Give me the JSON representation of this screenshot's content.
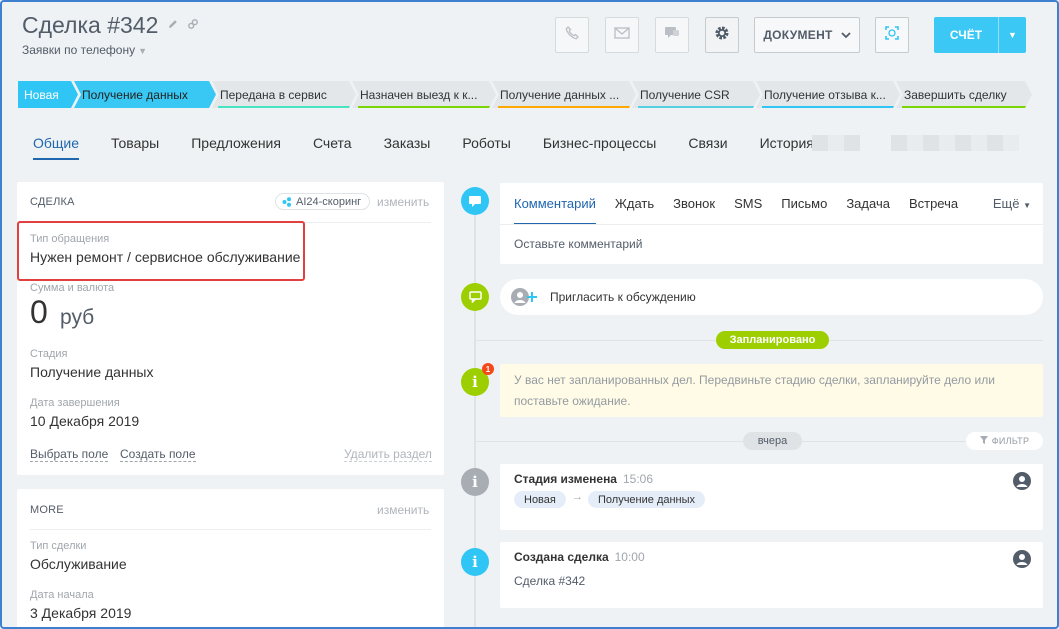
{
  "header": {
    "title": "Сделка #342",
    "category": "Заявки по телефону",
    "document_label": "ДОКУМЕНТ",
    "invoice_label": "СЧЁТ"
  },
  "stages": [
    {
      "label": "Новая",
      "state": "active",
      "color": "#2fc6f6"
    },
    {
      "label": "Получение данных",
      "state": "active",
      "color": "#2fc6f6"
    },
    {
      "label": "Передана в сервис",
      "state": "todo",
      "color": "#47e4c2"
    },
    {
      "label": "Назначен выезд к к...",
      "state": "todo",
      "color": "#7bd500"
    },
    {
      "label": "Получение данных ...",
      "state": "todo",
      "color": "#ffa900"
    },
    {
      "label": "Получение CSR",
      "state": "todo",
      "color": "#55d0e0"
    },
    {
      "label": "Получение отзыва к...",
      "state": "todo",
      "color": "#2fc6f6"
    },
    {
      "label": "Завершить сделку",
      "state": "todo",
      "color": "#7bd500"
    }
  ],
  "tabs": [
    "Общие",
    "Товары",
    "Предложения",
    "Счета",
    "Заказы",
    "Роботы",
    "Бизнес-процессы",
    "Связи",
    "История"
  ],
  "deal_card": {
    "heading": "СДЕЛКА",
    "ai_badge": "AI24-скоринг",
    "change_label": "изменить",
    "request_type_label": "Тип обращения",
    "request_type_value": "Нужен ремонт / сервисное обслуживание",
    "amount_label": "Сумма и валюта",
    "amount_value": "0",
    "currency": "руб",
    "stage_label": "Стадия",
    "stage_value": "Получение данных",
    "close_date_label": "Дата завершения",
    "close_date_value": "10 Декабря 2019",
    "select_field": "Выбрать поле",
    "create_field": "Создать поле",
    "delete_section": "Удалить раздел"
  },
  "more_card": {
    "heading": "MORE",
    "change_label": "изменить",
    "deal_type_label": "Тип сделки",
    "deal_type_value": "Обслуживание",
    "start_date_label": "Дата начала",
    "start_date_value": "3 Декабря 2019"
  },
  "composer": {
    "tabs": [
      "Комментарий",
      "Ждать",
      "Звонок",
      "SMS",
      "Письмо",
      "Задача",
      "Встреча"
    ],
    "more_label": "Ещё",
    "placeholder": "Оставьте комментарий"
  },
  "timeline": {
    "invite_label": "Пригласить к обсуждению",
    "planned_label": "Запланировано",
    "planned_badge_count": "1",
    "notice_text": "У вас нет запланированных дел. Передвиньте стадию сделки, запланируйте дело или поставьте ожидание.",
    "yesterday_label": "вчера",
    "filter_label": "ФИЛЬТР",
    "events": [
      {
        "title": "Стадия изменена",
        "time": "15:06",
        "from": "Новая",
        "to": "Получение данных"
      },
      {
        "title": "Создана сделка",
        "time": "10:00",
        "subtitle": "Сделка #342"
      }
    ]
  },
  "colors": {
    "accent": "#2067b0",
    "primary_button": "#3bc8f5",
    "planned_green": "#9dcf00",
    "highlight_red": "#e0413f"
  }
}
